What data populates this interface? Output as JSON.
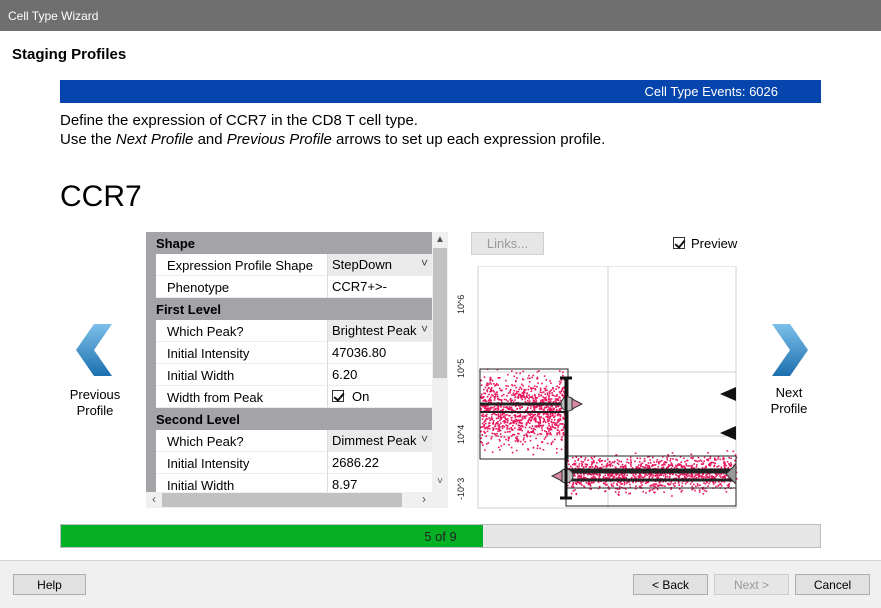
{
  "window": {
    "title": "Cell Type Wizard"
  },
  "page": {
    "heading": "Staging Profiles"
  },
  "events_bar": {
    "text": "Cell Type Events: 6026",
    "color": "#0645ad"
  },
  "instructions": {
    "line1": "Define the expression of CCR7 in the CD8 T cell type.",
    "line2_pre": "Use the ",
    "line2_next": "Next Profile",
    "line2_mid": " and ",
    "line2_prev": "Previous Profile",
    "line2_post": " arrows to set up each expression profile."
  },
  "marker": {
    "name": "CCR7"
  },
  "nav": {
    "previous": {
      "line1": "Previous",
      "line2": "Profile",
      "icon": "chevron-left-icon"
    },
    "next": {
      "line1": "Next",
      "line2": "Profile",
      "icon": "chevron-right-icon"
    },
    "arrow_color": "#2e8bc9"
  },
  "properties": {
    "shape_section": "Shape",
    "expression_profile_shape": {
      "label": "Expression Profile Shape",
      "value": "StepDown"
    },
    "phenotype": {
      "label": "Phenotype",
      "value": "CCR7+>-"
    },
    "first_section": "First Level",
    "first_which_peak": {
      "label": "Which Peak?",
      "value": "Brightest Peak"
    },
    "first_initial_intensity": {
      "label": "Initial Intensity",
      "value": "47036.80"
    },
    "first_initial_width": {
      "label": "Initial Width",
      "value": "6.20"
    },
    "first_width_from_peak": {
      "label": "Width from Peak",
      "value": "On"
    },
    "second_section": "Second Level",
    "second_which_peak": {
      "label": "Which Peak?",
      "value": "Dimmest Peak"
    },
    "second_initial_intensity": {
      "label": "Initial Intensity",
      "value": "2686.22"
    },
    "second_initial_width": {
      "label": "Initial Width",
      "value": "8.97"
    }
  },
  "links_button": {
    "label": "Links..."
  },
  "preview": {
    "label": "Preview",
    "checked": true
  },
  "plot": {
    "y_tick_labels": [
      "10^6",
      "10^5",
      "10^4",
      "-10^3"
    ],
    "dot_color": "#e8175d"
  },
  "progress": {
    "text": "5 of 9",
    "current": 5,
    "total": 9,
    "color": "#06b025"
  },
  "footer": {
    "help": "Help",
    "back": "< Back",
    "next": "Next >",
    "cancel": "Cancel"
  }
}
